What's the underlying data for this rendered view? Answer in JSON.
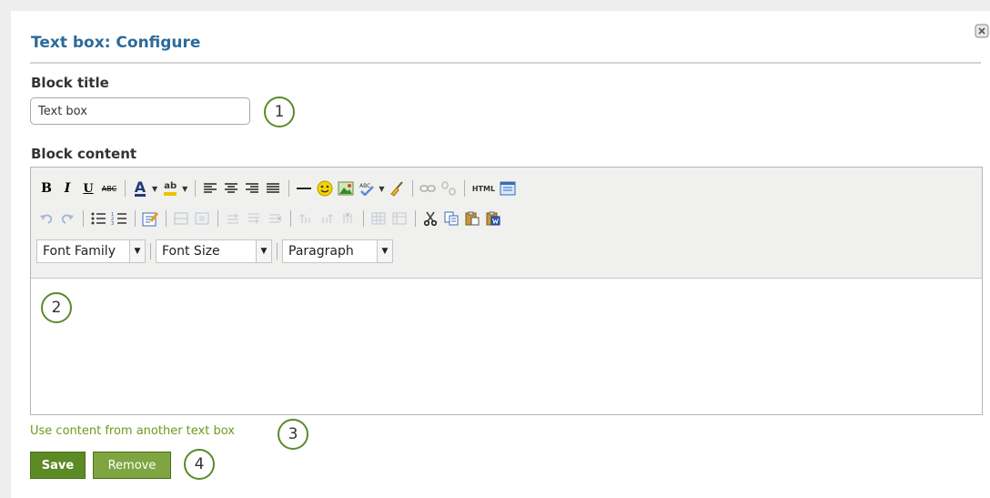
{
  "dialog": {
    "title": "Text box: Configure",
    "block_title_label": "Block title",
    "block_title_value": "Text box",
    "block_content_label": "Block content",
    "use_content_link": "Use content from another text box",
    "save_label": "Save",
    "remove_label": "Remove"
  },
  "callouts": [
    "1",
    "2",
    "3",
    "4"
  ],
  "toolbar": {
    "bold": "B",
    "italic": "I",
    "underline": "U",
    "strikethrough": "ABC",
    "font_color": "A",
    "highlight": "ab",
    "html": "HTML",
    "font_family": "Font Family",
    "font_size": "Font Size",
    "format": "Paragraph"
  },
  "colors": {
    "title": "#2d6a99",
    "link": "#6e9a1e",
    "save_bg": "#5c8a25",
    "remove_bg": "#7ea542",
    "callout_border": "#5a8a2a"
  }
}
